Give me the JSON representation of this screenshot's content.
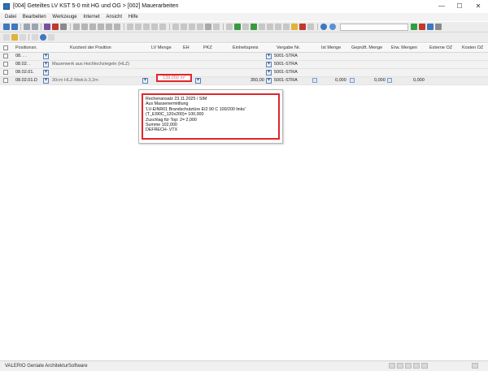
{
  "window": {
    "title": "[004] Geteiltes LV KST 5-0 mit HG und OG > [002] Mauerarbeiten",
    "minimize": "—",
    "maximize": "☐",
    "close": "✕"
  },
  "menu": [
    "Datei",
    "Bearbeiten",
    "Werkzeuge",
    "Internet",
    "Ansicht",
    "Hilfe"
  ],
  "toolbar": {
    "search_value": "",
    "dropdown_glyph": "▾"
  },
  "grid": {
    "columns": {
      "posnr": "Positionsn.",
      "kurztext": "Kurztext der Position",
      "lvmenge": "LV Menge",
      "eh": "EH",
      "pkz": "PKZ",
      "ep": "Einheitspreis",
      "vergabe": "Vergabe Nr.",
      "istmenge": "Ist Menge",
      "gepruef": "Geprüft. Menge",
      "erw": "Erw. Mengen",
      "extern": "Externe OZ",
      "kosten": "Kosten OZ"
    },
    "rows": [
      {
        "posnr": "08. .  .",
        "kurztext": "",
        "vergabe": "5001-STRA"
      },
      {
        "posnr": "08.02.  .",
        "kurztext": "Mauerwerk aus Hochlochziegeln (HLZ)",
        "vergabe": "5001-STRA"
      },
      {
        "posnr": "08.02.01.",
        "kurztext": "",
        "vergabe": "5001-STRA"
      },
      {
        "posnr": "08.02.01.D",
        "kurztext": "30cm HLZ-Mwk.b.3,2m",
        "lvmenge": "139,050 m²",
        "ep": "350,00",
        "vergabe": "5001-STRA",
        "istmenge": "0,000",
        "gepruef": "0,000",
        "erw": "0,000"
      }
    ]
  },
  "tooltip": {
    "lines": [
      "Rechenansatz 23.11.2025 / SIM",
      "Aus Massenermittlung",
      "'LV-EINR01 Brandschutztüre EI2 90 C 100/200 links'",
      "(T_EI90C_120x200)= 100,000",
      "Zuschlag für Top: 2= 2,000",
      "Summe 102,000",
      "DEFRECH-.VTX"
    ]
  },
  "status": {
    "text": "VALERIO Geniale ArchitekturSoftware"
  },
  "colors": {
    "highlight_red": "#e0262c",
    "plus_blue": "#1f3f78"
  }
}
